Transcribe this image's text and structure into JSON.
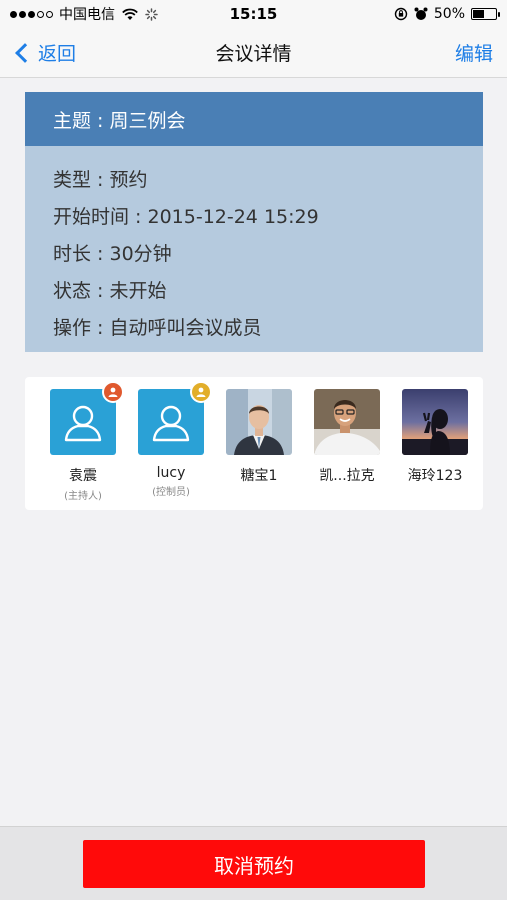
{
  "status_bar": {
    "carrier": "中国电信",
    "time": "15:15",
    "battery": "50%",
    "battery_level": 0.5
  },
  "nav": {
    "back_label": "返回",
    "title": "会议详情",
    "edit_label": "编辑"
  },
  "meeting": {
    "subject": "主题 : 周三例会",
    "rows": [
      "类型 : 预约",
      "开始时间 : 2015-12-24 15:29",
      "时长 : 30分钟",
      "状态 : 未开始",
      "操作 : 自动呼叫会议成员"
    ]
  },
  "participants": [
    {
      "name": "袁震",
      "role": "(主持人)",
      "avatar": "default-user-icon",
      "badge": "host-badge-icon"
    },
    {
      "name": "lucy",
      "role": "(控制员)",
      "avatar": "default-user-icon",
      "badge": "controller-badge-icon"
    },
    {
      "name": "糖宝1",
      "role": "",
      "avatar": "photo-businessman"
    },
    {
      "name": "凯...拉克",
      "role": "",
      "avatar": "photo-smiling-man"
    },
    {
      "name": "海玲123",
      "role": "",
      "avatar": "photo-sunset-girl"
    }
  ],
  "footer": {
    "cancel_label": "取消预约"
  },
  "colors": {
    "accent": "#1e7ee6",
    "header_blue": "#4a7fb5",
    "card_blue": "#b5cade",
    "avatar_blue": "#2aa1d6",
    "cancel_red": "#ff0a0a"
  }
}
